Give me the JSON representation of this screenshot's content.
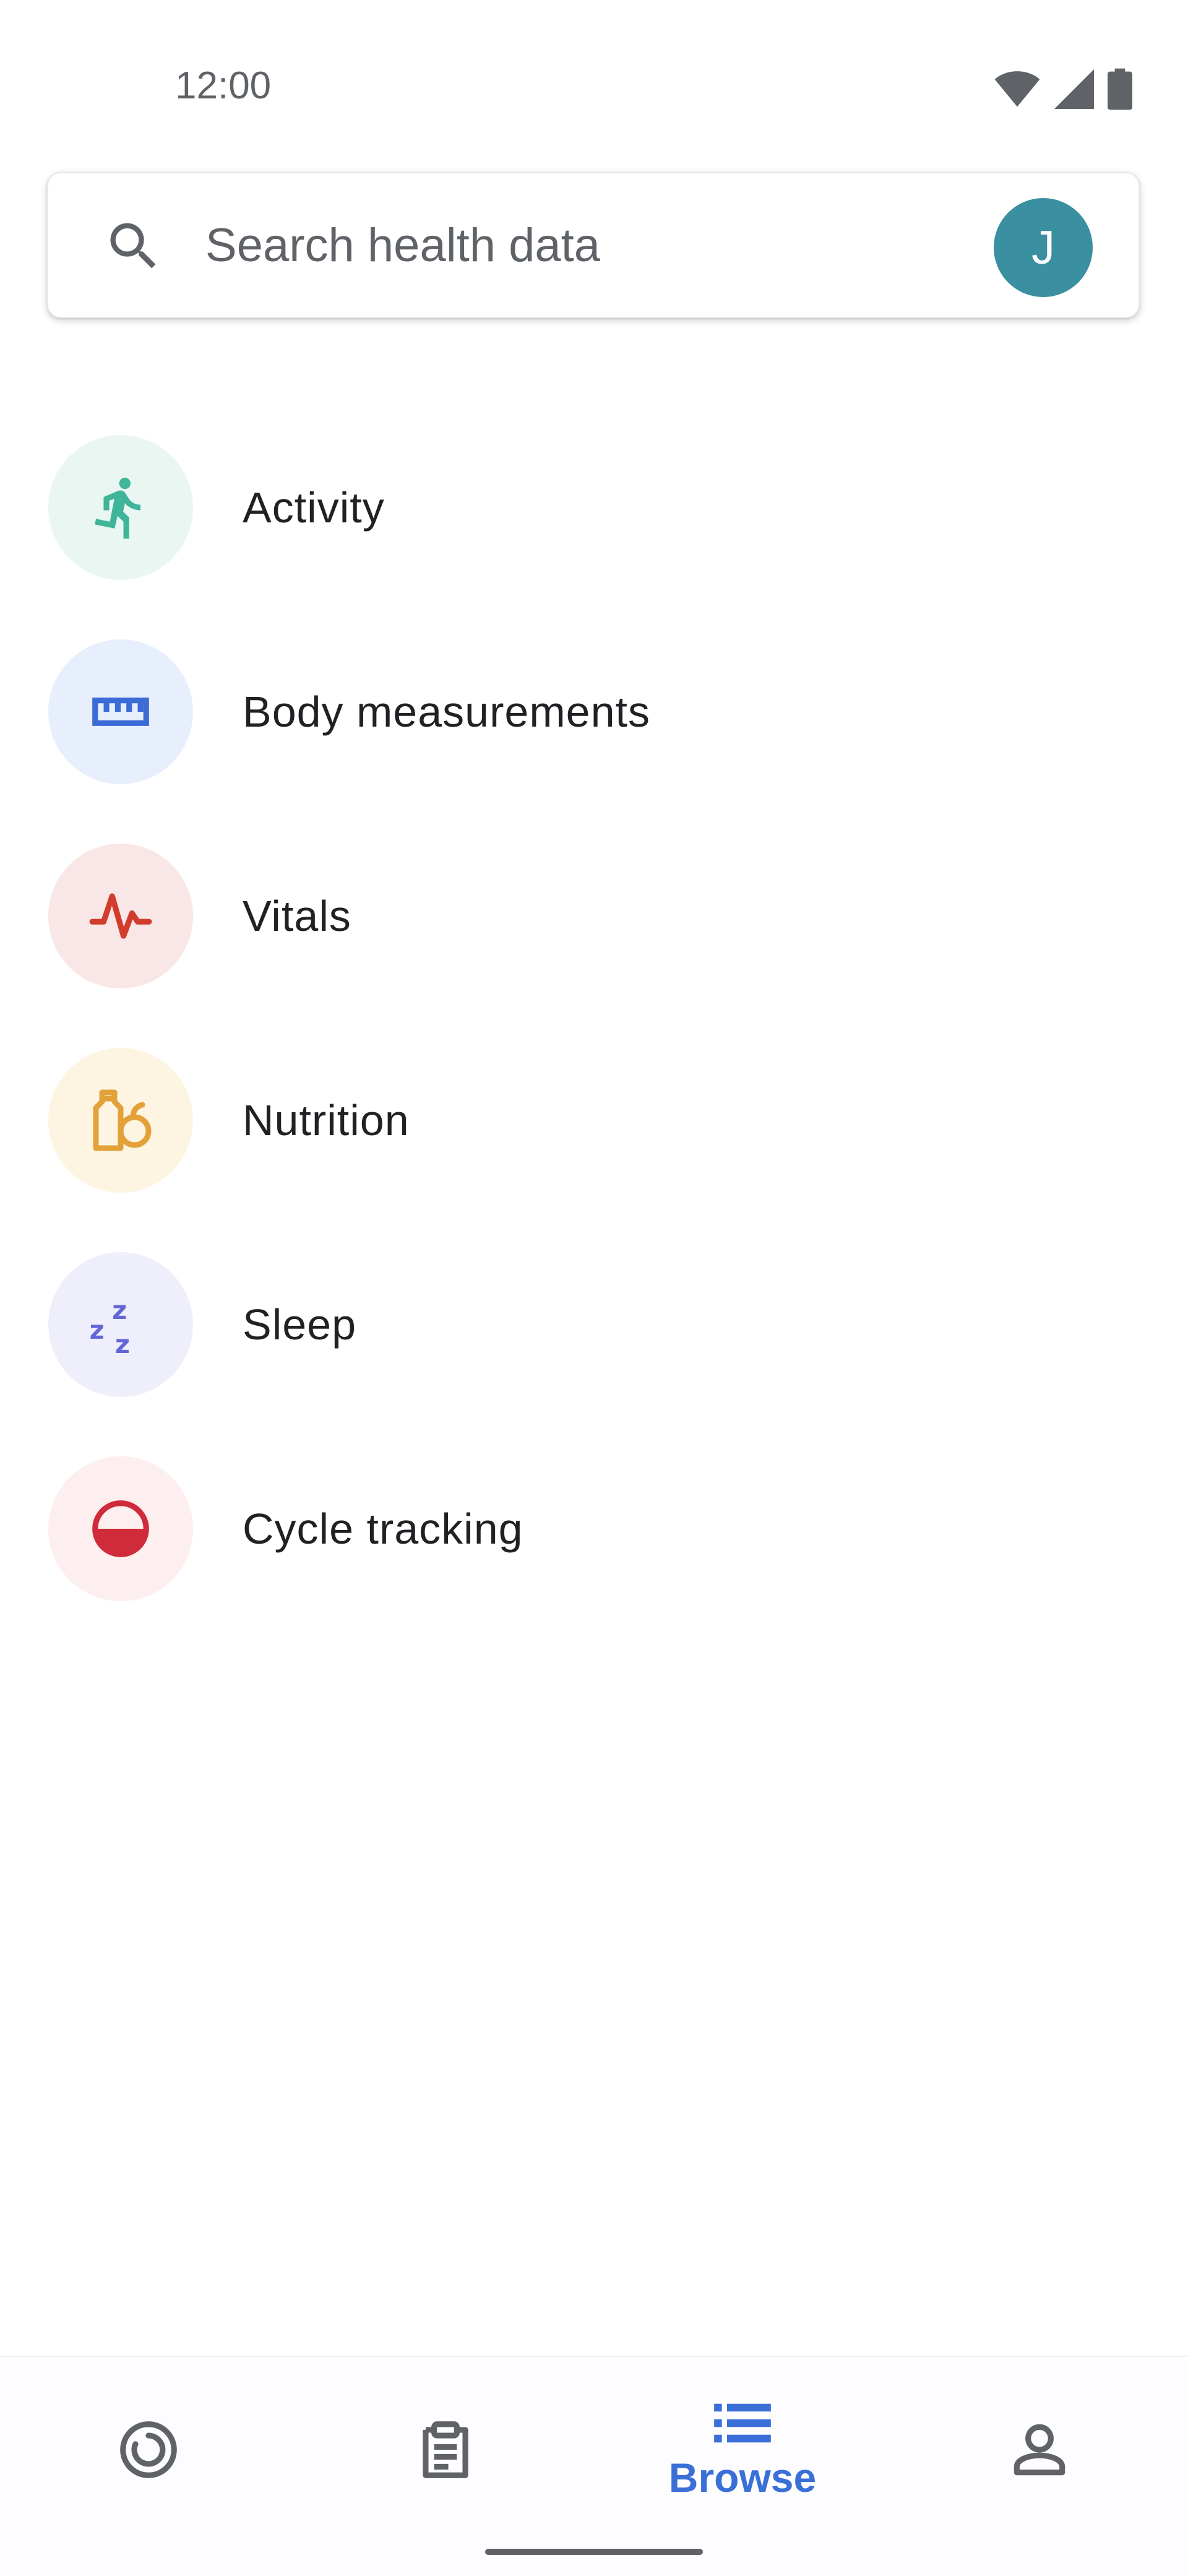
{
  "status_bar": {
    "time": "12:00",
    "icons": [
      "wifi-icon",
      "signal-icon",
      "battery-icon"
    ]
  },
  "search": {
    "placeholder": "Search health data",
    "avatar_initial": "J",
    "avatar_color": "#3a8fa0"
  },
  "categories": [
    {
      "label": "Activity",
      "icon": "running-person-icon",
      "icon_color": "#3fb59a",
      "bg_color": "#e9f6f2"
    },
    {
      "label": "Body measurements",
      "icon": "ruler-icon",
      "icon_color": "#3a6bd6",
      "bg_color": "#e8effc"
    },
    {
      "label": "Vitals",
      "icon": "heartbeat-icon",
      "icon_color": "#d23c2c",
      "bg_color": "#f8e7e6"
    },
    {
      "label": "Nutrition",
      "icon": "nutrition-icon",
      "icon_color": "#e3a13a",
      "bg_color": "#fdf5e2"
    },
    {
      "label": "Sleep",
      "icon": "zzz-icon",
      "icon_color": "#6466d8",
      "bg_color": "#eeeffa"
    },
    {
      "label": "Cycle tracking",
      "icon": "cycle-icon",
      "icon_color": "#d02b3a",
      "bg_color": "#fdeef0"
    }
  ],
  "bottom_nav": {
    "items": [
      {
        "icon": "today-ring-icon",
        "label": "",
        "active": false
      },
      {
        "icon": "journal-clipboard-icon",
        "label": "",
        "active": false
      },
      {
        "icon": "browse-list-icon",
        "label": "Browse",
        "active": true
      },
      {
        "icon": "profile-icon",
        "label": "",
        "active": false
      }
    ],
    "active_color": "#3b6fd8",
    "inactive_color": "#5f6368"
  }
}
